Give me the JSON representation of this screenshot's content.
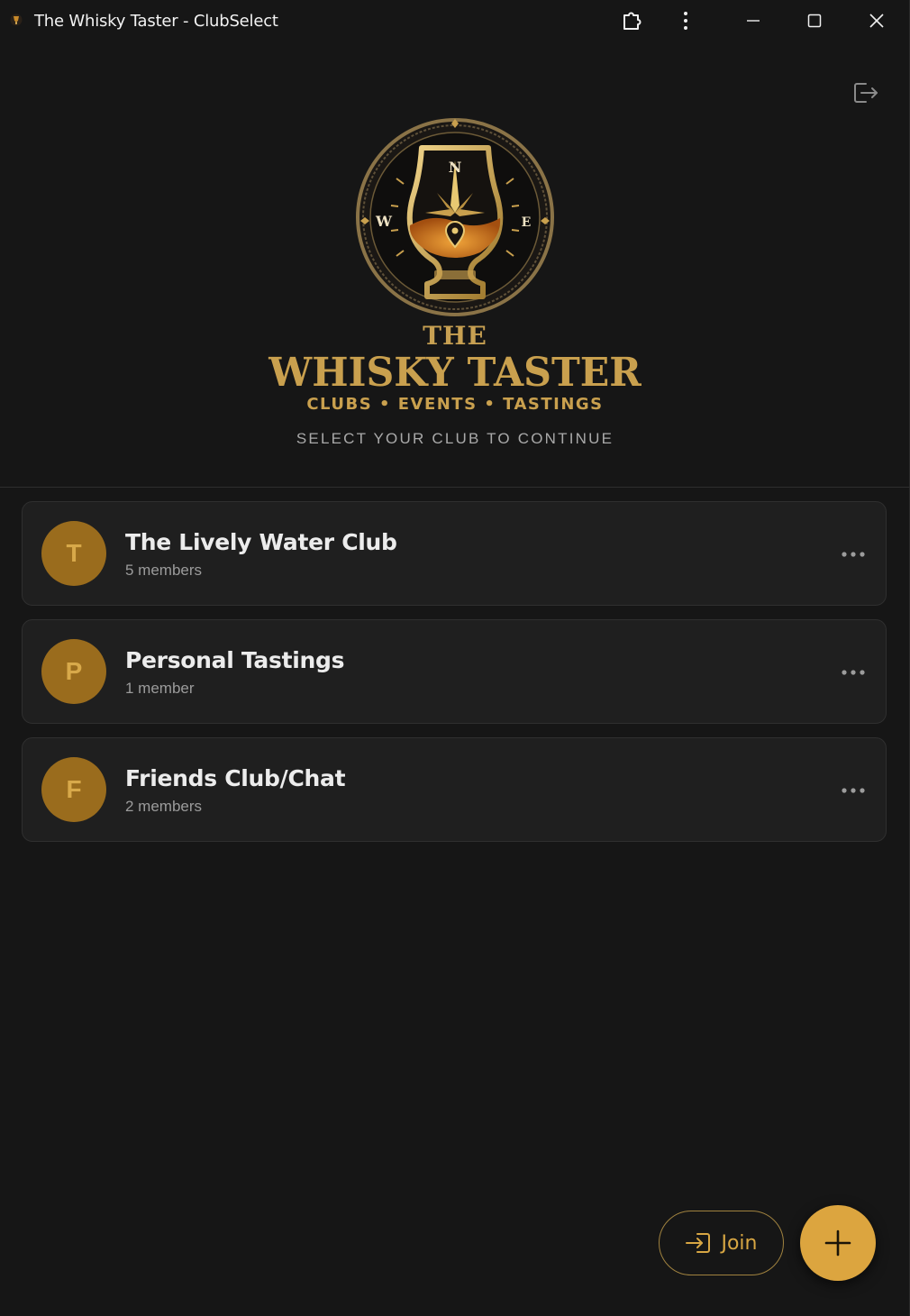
{
  "window": {
    "title": "The Whisky Taster - ClubSelect"
  },
  "header": {
    "brand_the": "THE",
    "brand_main": "WHISKY TASTER",
    "brand_tagline": "CLUBS • EVENTS • TASTINGS",
    "emblem_letters": {
      "n": "N",
      "w": "W",
      "e": "E"
    },
    "caption": "SELECT YOUR CLUB TO CONTINUE"
  },
  "clubs": [
    {
      "initial": "T",
      "name": "The Lively Water Club",
      "members": "5 members"
    },
    {
      "initial": "P",
      "name": "Personal Tastings",
      "members": "1 member"
    },
    {
      "initial": "F",
      "name": "Friends Club/Chat",
      "members": "2 members"
    }
  ],
  "actions": {
    "join_label": "Join"
  },
  "colors": {
    "background": "#161616",
    "card": "#1f1f1f",
    "accent": "#dca53f",
    "avatar": "#9a6c1d",
    "gold_text": "#c9a04e"
  },
  "icons": {
    "titlebar": [
      "extensions-icon",
      "more-vertical-icon",
      "minimize-icon",
      "maximize-icon",
      "close-icon"
    ],
    "logout": "logout-icon",
    "club_menu": "more-horizontal-icon",
    "join": "login-icon",
    "add": "plus-icon"
  }
}
